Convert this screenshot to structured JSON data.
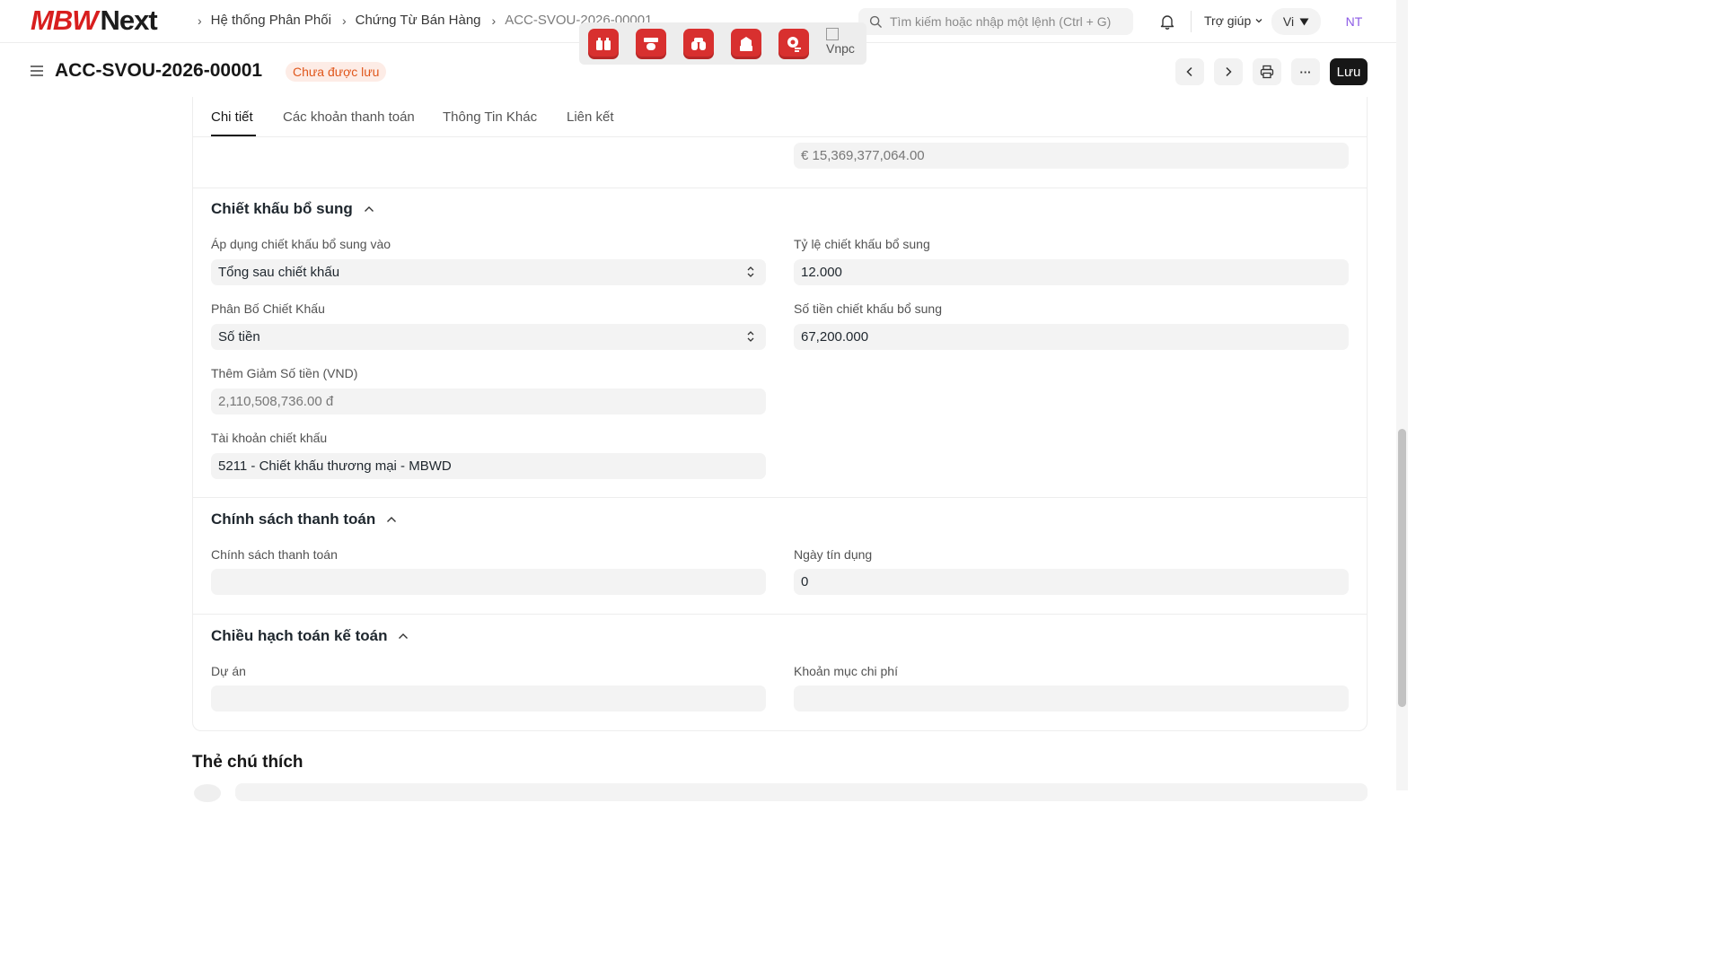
{
  "navbar": {
    "logo_brand": "MBW",
    "logo_next": "Next",
    "breadcrumbs": [
      "Hệ thống Phân Phối",
      "Chứng Từ Bán Hàng",
      "ACC-SVOU-2026-00001"
    ],
    "search_placeholder": "Tìm kiếm hoặc nhập một lệnh (Ctrl + G)",
    "help_label": "Trợ giúp",
    "lang_label": "Vi",
    "avatar_initials": "NT"
  },
  "apptray": {
    "broken_image_alt": "Vnpc"
  },
  "header": {
    "title": "ACC-SVOU-2026-00001",
    "status_badge": "Chưa được lưu",
    "save_label": "Lưu",
    "more_label": "···"
  },
  "tabs": [
    "Chi tiết",
    "Các khoản thanh toán",
    "Thông Tin Khác",
    "Liên kết"
  ],
  "top_field": {
    "value": "€ 15,369,377,064.00"
  },
  "discount_section": {
    "title": "Chiết khấu bổ sung",
    "apply_on_label": "Áp dụng chiết khấu bổ sung vào",
    "apply_on_value": "Tổng sau chiết khấu",
    "rate_label": "Tỷ lệ chiết khấu bổ sung",
    "rate_value": "12.000",
    "distribution_label": "Phân Bố Chiết Khấu",
    "distribution_value": "Số tiền",
    "amount_label": "Số tiền chiết khấu bổ sung",
    "amount_value": "67,200.000",
    "base_amount_label": "Thêm Giảm Số tiền (VND)",
    "base_amount_value": "2,110,508,736.00 đ",
    "account_label": "Tài khoản chiết khấu",
    "account_value": "5211 - Chiết khấu thương mại - MBWD"
  },
  "payment_section": {
    "title": "Chính sách thanh toán",
    "policy_label": "Chính sách thanh toán",
    "policy_value": "",
    "credit_days_label": "Ngày tín dụng",
    "credit_days_value": "0"
  },
  "accounting_section": {
    "title": "Chiều hạch toán kế toán",
    "project_label": "Dự án",
    "project_value": "",
    "cost_center_label": "Khoản mục chi phí",
    "cost_center_value": ""
  },
  "notes": {
    "title": "Thẻ chú thích"
  },
  "colors": {
    "brand_red": "#d81e1e",
    "badge_orange": "#e0571c",
    "avatar_purple": "#8c5be6"
  }
}
